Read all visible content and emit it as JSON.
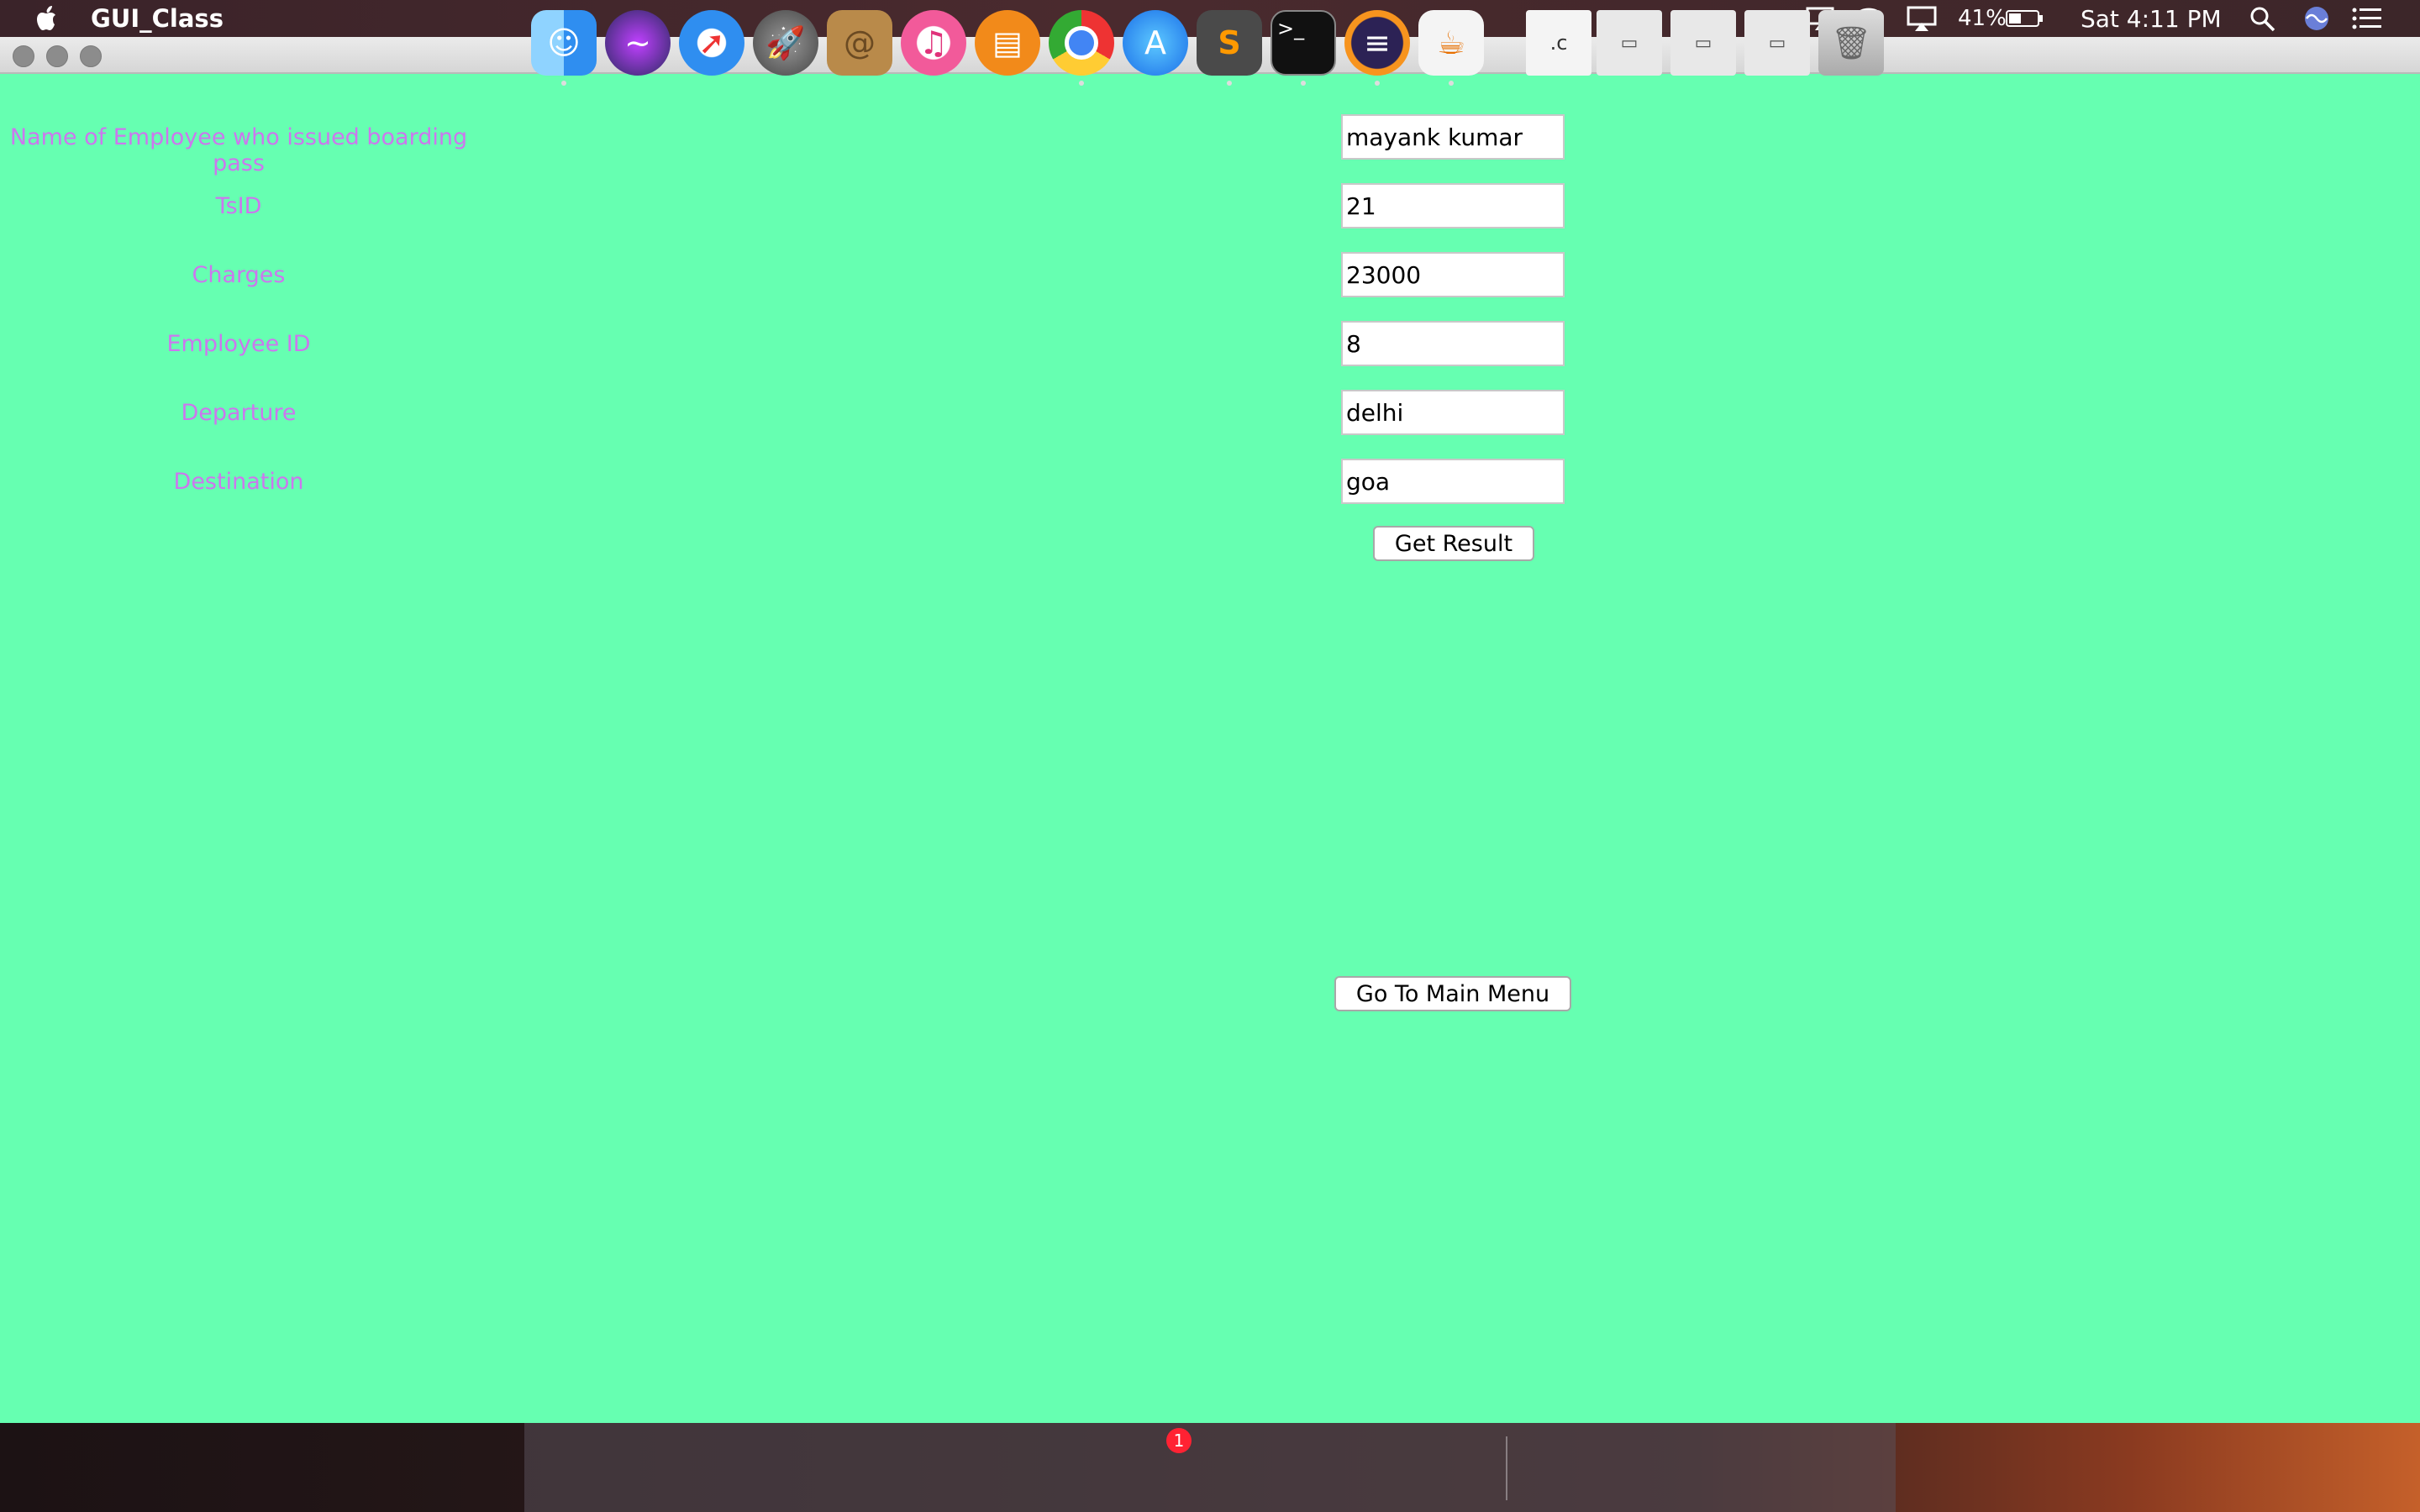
{
  "menubar": {
    "app_name": "GUI_Class",
    "battery_percent": "41%",
    "clock": "Sat 4:11 PM"
  },
  "form": {
    "fields": [
      {
        "label": "Name of Employee who issued boarding pass",
        "value": "mayank kumar"
      },
      {
        "label": "TsID",
        "value": "21"
      },
      {
        "label": "Charges",
        "value": "23000"
      },
      {
        "label": "Employee ID",
        "value": "8"
      },
      {
        "label": "Departure",
        "value": "delhi"
      },
      {
        "label": "Destination",
        "value": "goa"
      }
    ],
    "get_result_label": "Get Result",
    "main_menu_label": "Go To Main Menu"
  },
  "colors": {
    "window_background": "#66ffb1",
    "label_text": "#cc77ee"
  },
  "dock": {
    "items": [
      "finder-icon",
      "siri-icon",
      "safari-icon",
      "launchpad-icon",
      "contacts-icon",
      "itunes-icon",
      "ibooks-icon",
      "chrome-icon",
      "app-store-icon",
      "sublime-text-icon",
      "terminal-icon",
      "eclipse-icon",
      "java-icon"
    ],
    "app_store_badge": "1",
    "recent_items": [
      "c-file-icon",
      "chrome-window-thumbnail",
      "chrome-window-thumbnail",
      "eclipse-window-thumbnail",
      "trash-icon"
    ]
  }
}
